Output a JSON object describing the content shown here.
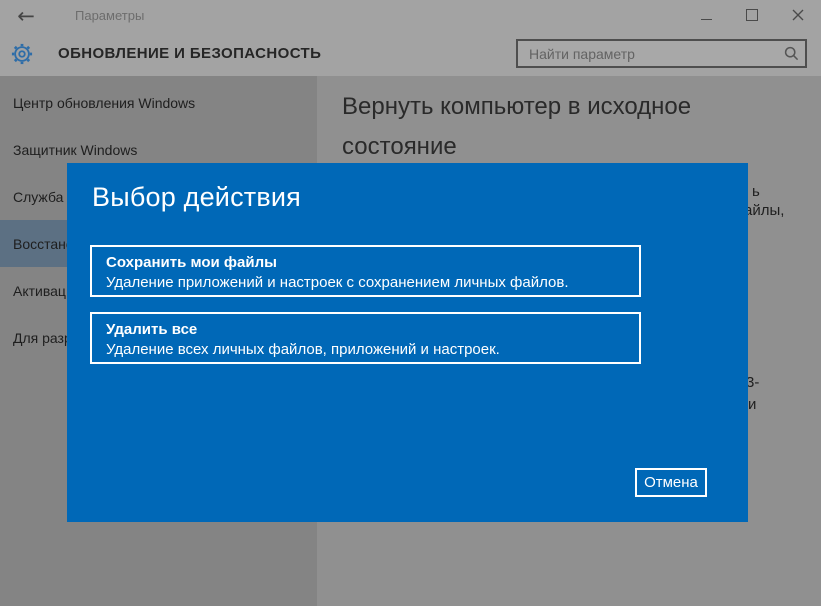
{
  "window": {
    "titlebar": {
      "back_label": "←",
      "title": "Параметры",
      "controls": {
        "minimize": "minimize",
        "maximize": "maximize",
        "close": "close"
      }
    },
    "header": {
      "page_title": "ОБНОВЛЕНИЕ И БЕЗОПАСНОСТЬ",
      "search": {
        "placeholder": "Найти параметр",
        "value": ""
      }
    },
    "sidebar": {
      "items": [
        {
          "label": "Центр обновления Windows",
          "selected": false
        },
        {
          "label": "Защитник Windows",
          "selected": false
        },
        {
          "label": "Служба а",
          "selected": false
        },
        {
          "label": "Восстано",
          "selected": true
        },
        {
          "label": "Активац",
          "selected": false
        },
        {
          "label": "Для разр",
          "selected": false
        }
      ]
    },
    "content": {
      "heading": "Вернуть компьютер в исходное состояние",
      "clipped_fragments": [
        "ь",
        "айлы,",
        "3-",
        "и"
      ]
    }
  },
  "dialog": {
    "title": "Выбор действия",
    "options": [
      {
        "title": "Сохранить мои файлы",
        "description": "Удаление приложений и настроек с сохранением личных файлов."
      },
      {
        "title": "Удалить все",
        "description": "Удаление всех личных файлов, приложений и настроек."
      }
    ],
    "cancel_label": "Отмена"
  },
  "colors": {
    "dialog_blue": "#0068b7",
    "selected_item": "#5c7083",
    "dimmed_header": "#a3a3a3",
    "dimmed_sidebar": "#848484",
    "dimmed_content": "#909090",
    "accent_gear_blue": "#2e6da8"
  }
}
